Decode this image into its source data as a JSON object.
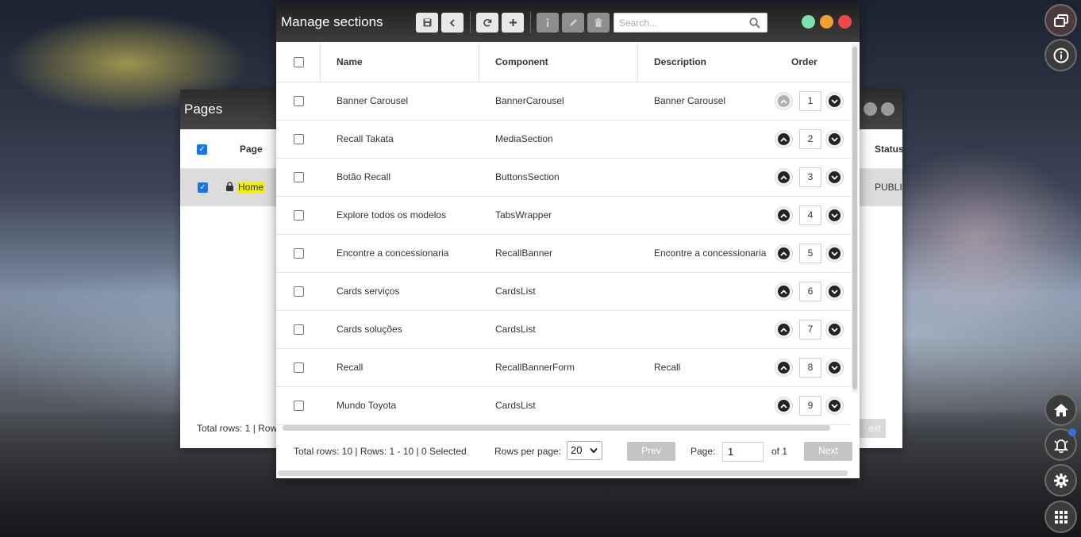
{
  "pages_window": {
    "title": "Pages",
    "columns": {
      "page": "Page",
      "status": "Status"
    },
    "row": {
      "page": "Home",
      "status": "PUBLI"
    },
    "footer": "Total rows: 1 | Row",
    "next_ghost": "ext"
  },
  "manage_sections": {
    "title": "Manage sections",
    "search": {
      "placeholder": "Search...",
      "value": ""
    },
    "toolbar": [
      "save-icon",
      "back-icon",
      "refresh-icon",
      "add-icon",
      "info-icon",
      "edit-icon",
      "delete-icon"
    ],
    "columns": {
      "name": "Name",
      "component": "Component",
      "description": "Description",
      "order": "Order"
    },
    "rows": [
      {
        "name": "Banner Carousel",
        "component": "BannerCarousel",
        "description": "Banner Carousel",
        "order": "1"
      },
      {
        "name": "Recall Takata",
        "component": "MediaSection",
        "description": "",
        "order": "2"
      },
      {
        "name": "Botão Recall",
        "component": "ButtonsSection",
        "description": "",
        "order": "3"
      },
      {
        "name": "Explore todos os modelos",
        "component": "TabsWrapper",
        "description": "",
        "order": "4"
      },
      {
        "name": "Encontre a concessionaria",
        "component": "RecallBanner",
        "description": "Encontre a concessionaria",
        "order": "5"
      },
      {
        "name": "Cards serviços",
        "component": "CardsList",
        "description": "",
        "order": "6"
      },
      {
        "name": "Cards soluções",
        "component": "CardsList",
        "description": "",
        "order": "7"
      },
      {
        "name": "Recall",
        "component": "RecallBannerForm",
        "description": "Recall",
        "order": "8"
      },
      {
        "name": "Mundo Toyota",
        "component": "CardsList",
        "description": "",
        "order": "9"
      }
    ],
    "footer": {
      "summary": "Total rows: 10 | Rows: 1 - 10 | 0 Selected",
      "rows_per_page_label": "Rows per page:",
      "rows_per_page_value": "20",
      "prev": "Prev",
      "page_label": "Page:",
      "page_value": "1",
      "of_label": "of 1",
      "next": "Next"
    },
    "window_dot_colors": [
      "#7ee0b0",
      "#f0a030",
      "#f04848"
    ]
  },
  "side_buttons": [
    "windows-icon",
    "info-icon",
    "home-icon",
    "bell-icon",
    "gear-icon",
    "grid-icon"
  ]
}
